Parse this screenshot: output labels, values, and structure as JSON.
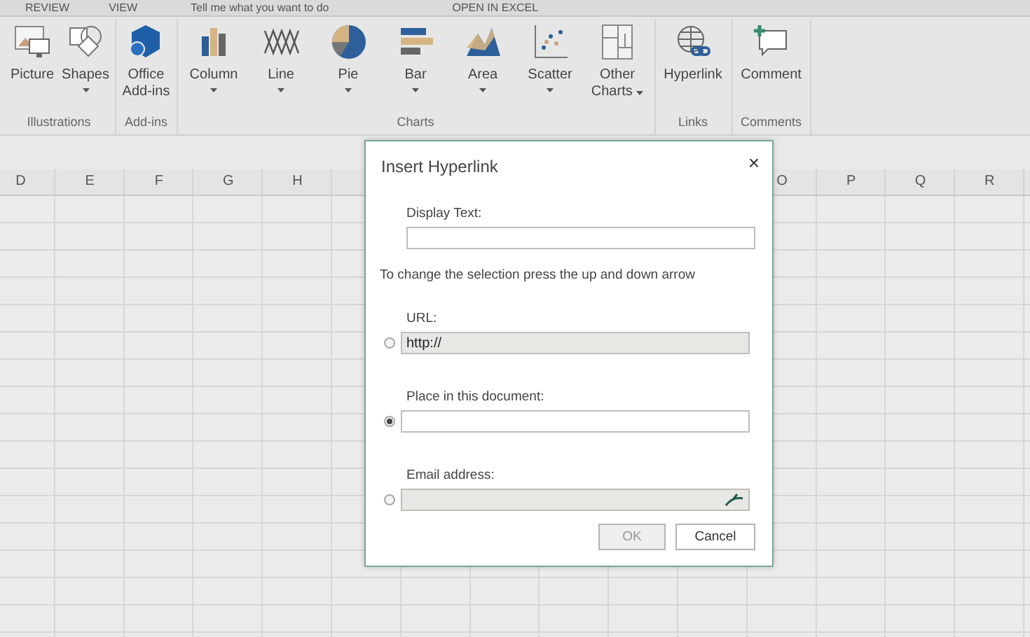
{
  "top_bar": {
    "tabs": [
      "REVIEW",
      "VIEW"
    ],
    "tell_me": "Tell me what you want to do",
    "open_in_excel": "OPEN IN EXCEL"
  },
  "ribbon": {
    "groups": [
      {
        "label": "Illustrations",
        "buttons": [
          {
            "label": "Picture",
            "kind": "picture",
            "dropdown": false
          },
          {
            "label": "Shapes",
            "kind": "shapes",
            "dropdown": true
          }
        ]
      },
      {
        "label": "Add-ins",
        "buttons": [
          {
            "label": "Office Add-ins",
            "kind": "addins",
            "dropdown": false
          }
        ]
      },
      {
        "label": "Charts",
        "buttons": [
          {
            "label": "Column",
            "kind": "column",
            "dropdown": true
          },
          {
            "label": "Line",
            "kind": "line",
            "dropdown": true
          },
          {
            "label": "Pie",
            "kind": "pie",
            "dropdown": true
          },
          {
            "label": "Bar",
            "kind": "bar",
            "dropdown": true
          },
          {
            "label": "Area",
            "kind": "area",
            "dropdown": true
          },
          {
            "label": "Scatter",
            "kind": "scatter",
            "dropdown": true
          },
          {
            "label": "Other Charts",
            "kind": "other",
            "dropdown": true
          }
        ]
      },
      {
        "label": "Links",
        "buttons": [
          {
            "label": "Hyperlink",
            "kind": "hyperlink",
            "dropdown": false
          }
        ]
      },
      {
        "label": "Comments",
        "buttons": [
          {
            "label": "Comment",
            "kind": "comment",
            "dropdown": false
          }
        ]
      }
    ]
  },
  "sheet": {
    "columns_left": [
      "D",
      "E",
      "F",
      "G",
      "H"
    ],
    "columns_right": [
      "O",
      "P",
      "Q",
      "R"
    ]
  },
  "dialog": {
    "title": "Insert Hyperlink",
    "close": "×",
    "display_text": {
      "label": "Display Text:"
    },
    "hint": "To change the selection press the up and down arrow",
    "options": [
      {
        "label": "URL:",
        "value": "http://",
        "selected": false,
        "disabled": true,
        "picker": false
      },
      {
        "label": "Place in this document:",
        "selected": true,
        "disabled": false,
        "picker": false
      },
      {
        "label": "Email address:",
        "selected": false,
        "disabled": true,
        "picker": true
      }
    ],
    "buttons": [
      {
        "label": "OK",
        "disabled": true
      },
      {
        "label": "Cancel",
        "disabled": false
      }
    ]
  }
}
